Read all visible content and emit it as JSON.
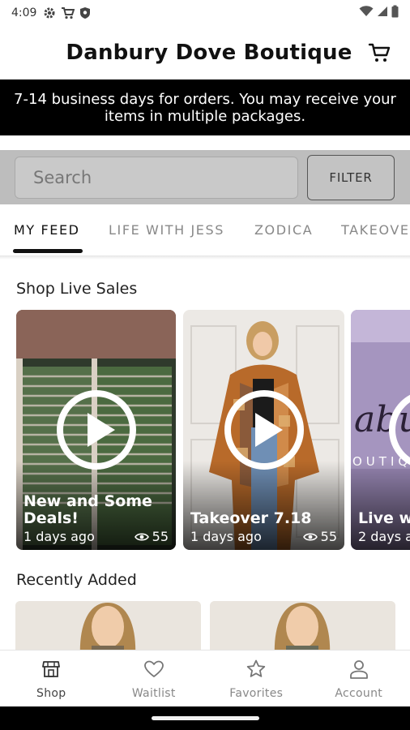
{
  "status_bar": {
    "time": "4:09"
  },
  "header": {
    "title": "Danbury Dove Boutique"
  },
  "banner": {
    "text": "7-14 business days for orders. You may receive your items in multiple packages."
  },
  "search": {
    "placeholder": "Search",
    "filter_label": "FILTER"
  },
  "tabs": [
    {
      "label": "MY FEED",
      "active": true
    },
    {
      "label": "LIFE WITH JESS",
      "active": false
    },
    {
      "label": "ZODICA",
      "active": false
    },
    {
      "label": "TAKEOVE",
      "active": false
    }
  ],
  "sections": {
    "live_sales": "Shop Live Sales",
    "recently_added": "Recently Added"
  },
  "live_cards": [
    {
      "title": "New and Some Deals!",
      "ago": "1 days ago",
      "views": "55"
    },
    {
      "title": "Takeover 7.18",
      "ago": "1 days ago",
      "views": "55"
    },
    {
      "title": "Live wi",
      "ago": "2 days a",
      "views": ""
    }
  ],
  "bottom_nav": [
    {
      "label": "Shop",
      "icon": "shop-icon",
      "active": true
    },
    {
      "label": "Waitlist",
      "icon": "heart-icon",
      "active": false
    },
    {
      "label": "Favorites",
      "icon": "star-icon",
      "active": false
    },
    {
      "label": "Account",
      "icon": "person-icon",
      "active": false
    }
  ],
  "colors": {
    "banner_bg": "#000000",
    "accent": "#111111",
    "search_band": "#bdbdbd"
  }
}
